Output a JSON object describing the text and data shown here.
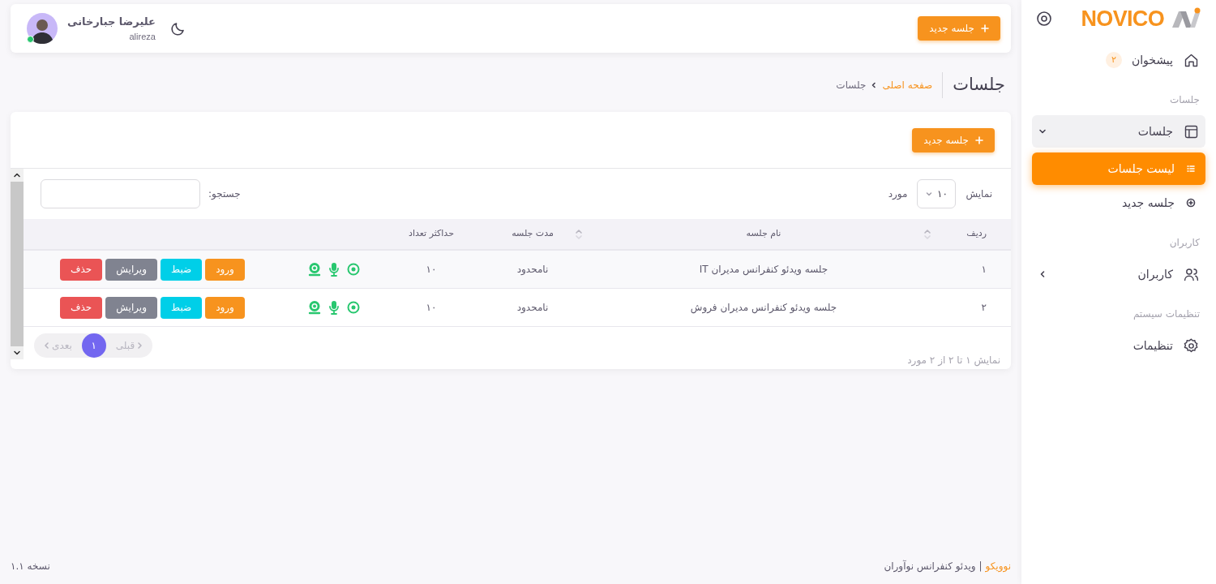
{
  "sidebar": {
    "brand": "NOVICO",
    "nav": [
      {
        "kind": "item",
        "label": "پیشخوان",
        "badge": "۲"
      },
      {
        "kind": "heading",
        "label": "جلسات"
      },
      {
        "kind": "group",
        "label": "جلسات",
        "expanded": true,
        "children": [
          {
            "label": "لیست جلسات",
            "selected": true
          },
          {
            "label": "جلسه جدید",
            "selected": false
          }
        ]
      },
      {
        "kind": "heading",
        "label": "کاربران"
      },
      {
        "kind": "group",
        "label": "کاربران",
        "expanded": false
      },
      {
        "kind": "heading",
        "label": "تنظیمات سیستم"
      },
      {
        "kind": "item",
        "label": "تنظیمات"
      }
    ]
  },
  "header": {
    "new_button": "جلسه جدید",
    "user": {
      "name": "علیرضا جبارخانی",
      "username": "alireza",
      "online": true
    }
  },
  "page": {
    "title": "جلسات",
    "breadcrumb": [
      {
        "label": "صفحه اصلی",
        "link": true
      },
      {
        "label": "جلسات",
        "link": false
      }
    ]
  },
  "card": {
    "new_button": "جلسه جدید",
    "show_label": "نمایش",
    "page_size": "۱۰",
    "unit": "مورد",
    "search_label": "جستجو:",
    "columns": [
      {
        "label": "ردیف",
        "sortable": false
      },
      {
        "label": "نام جلسه",
        "sortable": true
      },
      {
        "label": "مدت جلسه",
        "sortable": true
      },
      {
        "label": "حداکثر تعداد",
        "sortable": false
      }
    ],
    "rows": [
      {
        "index": "۱",
        "name": "جلسه ویدئو کنفرانس مدیران IT",
        "duration": "نامحدود",
        "capacity": "۱۰",
        "actions": [
          {
            "label": "ورود",
            "color": "#f7931e"
          },
          {
            "label": "ضبط",
            "color": "#00cfe8"
          },
          {
            "label": "ویرایش",
            "color": "#808390"
          },
          {
            "label": "حذف",
            "color": "#ea5455"
          }
        ]
      },
      {
        "index": "۲",
        "name": "جلسه ویدئو کنفرانس مدیران فروش",
        "duration": "نامحدود",
        "capacity": "۱۰",
        "actions": [
          {
            "label": "ورود",
            "color": "#f7931e"
          },
          {
            "label": "ضبط",
            "color": "#00cfe8"
          },
          {
            "label": "ویرایش",
            "color": "#808390"
          },
          {
            "label": "حذف",
            "color": "#ea5455"
          }
        ]
      }
    ],
    "info": "نمایش ۱ تا ۲ از ۲ مورد",
    "pagination": {
      "prev": {
        "label": "قبلی",
        "disabled": true
      },
      "pages": [
        {
          "label": "۱",
          "selected": true
        }
      ],
      "next": {
        "label": "بعدی",
        "disabled": true
      }
    }
  },
  "footer": {
    "brand": "نوویکو",
    "tagline": "| ویدئو کنفرانس نوآوران",
    "version": "نسخه ۱.۱"
  }
}
